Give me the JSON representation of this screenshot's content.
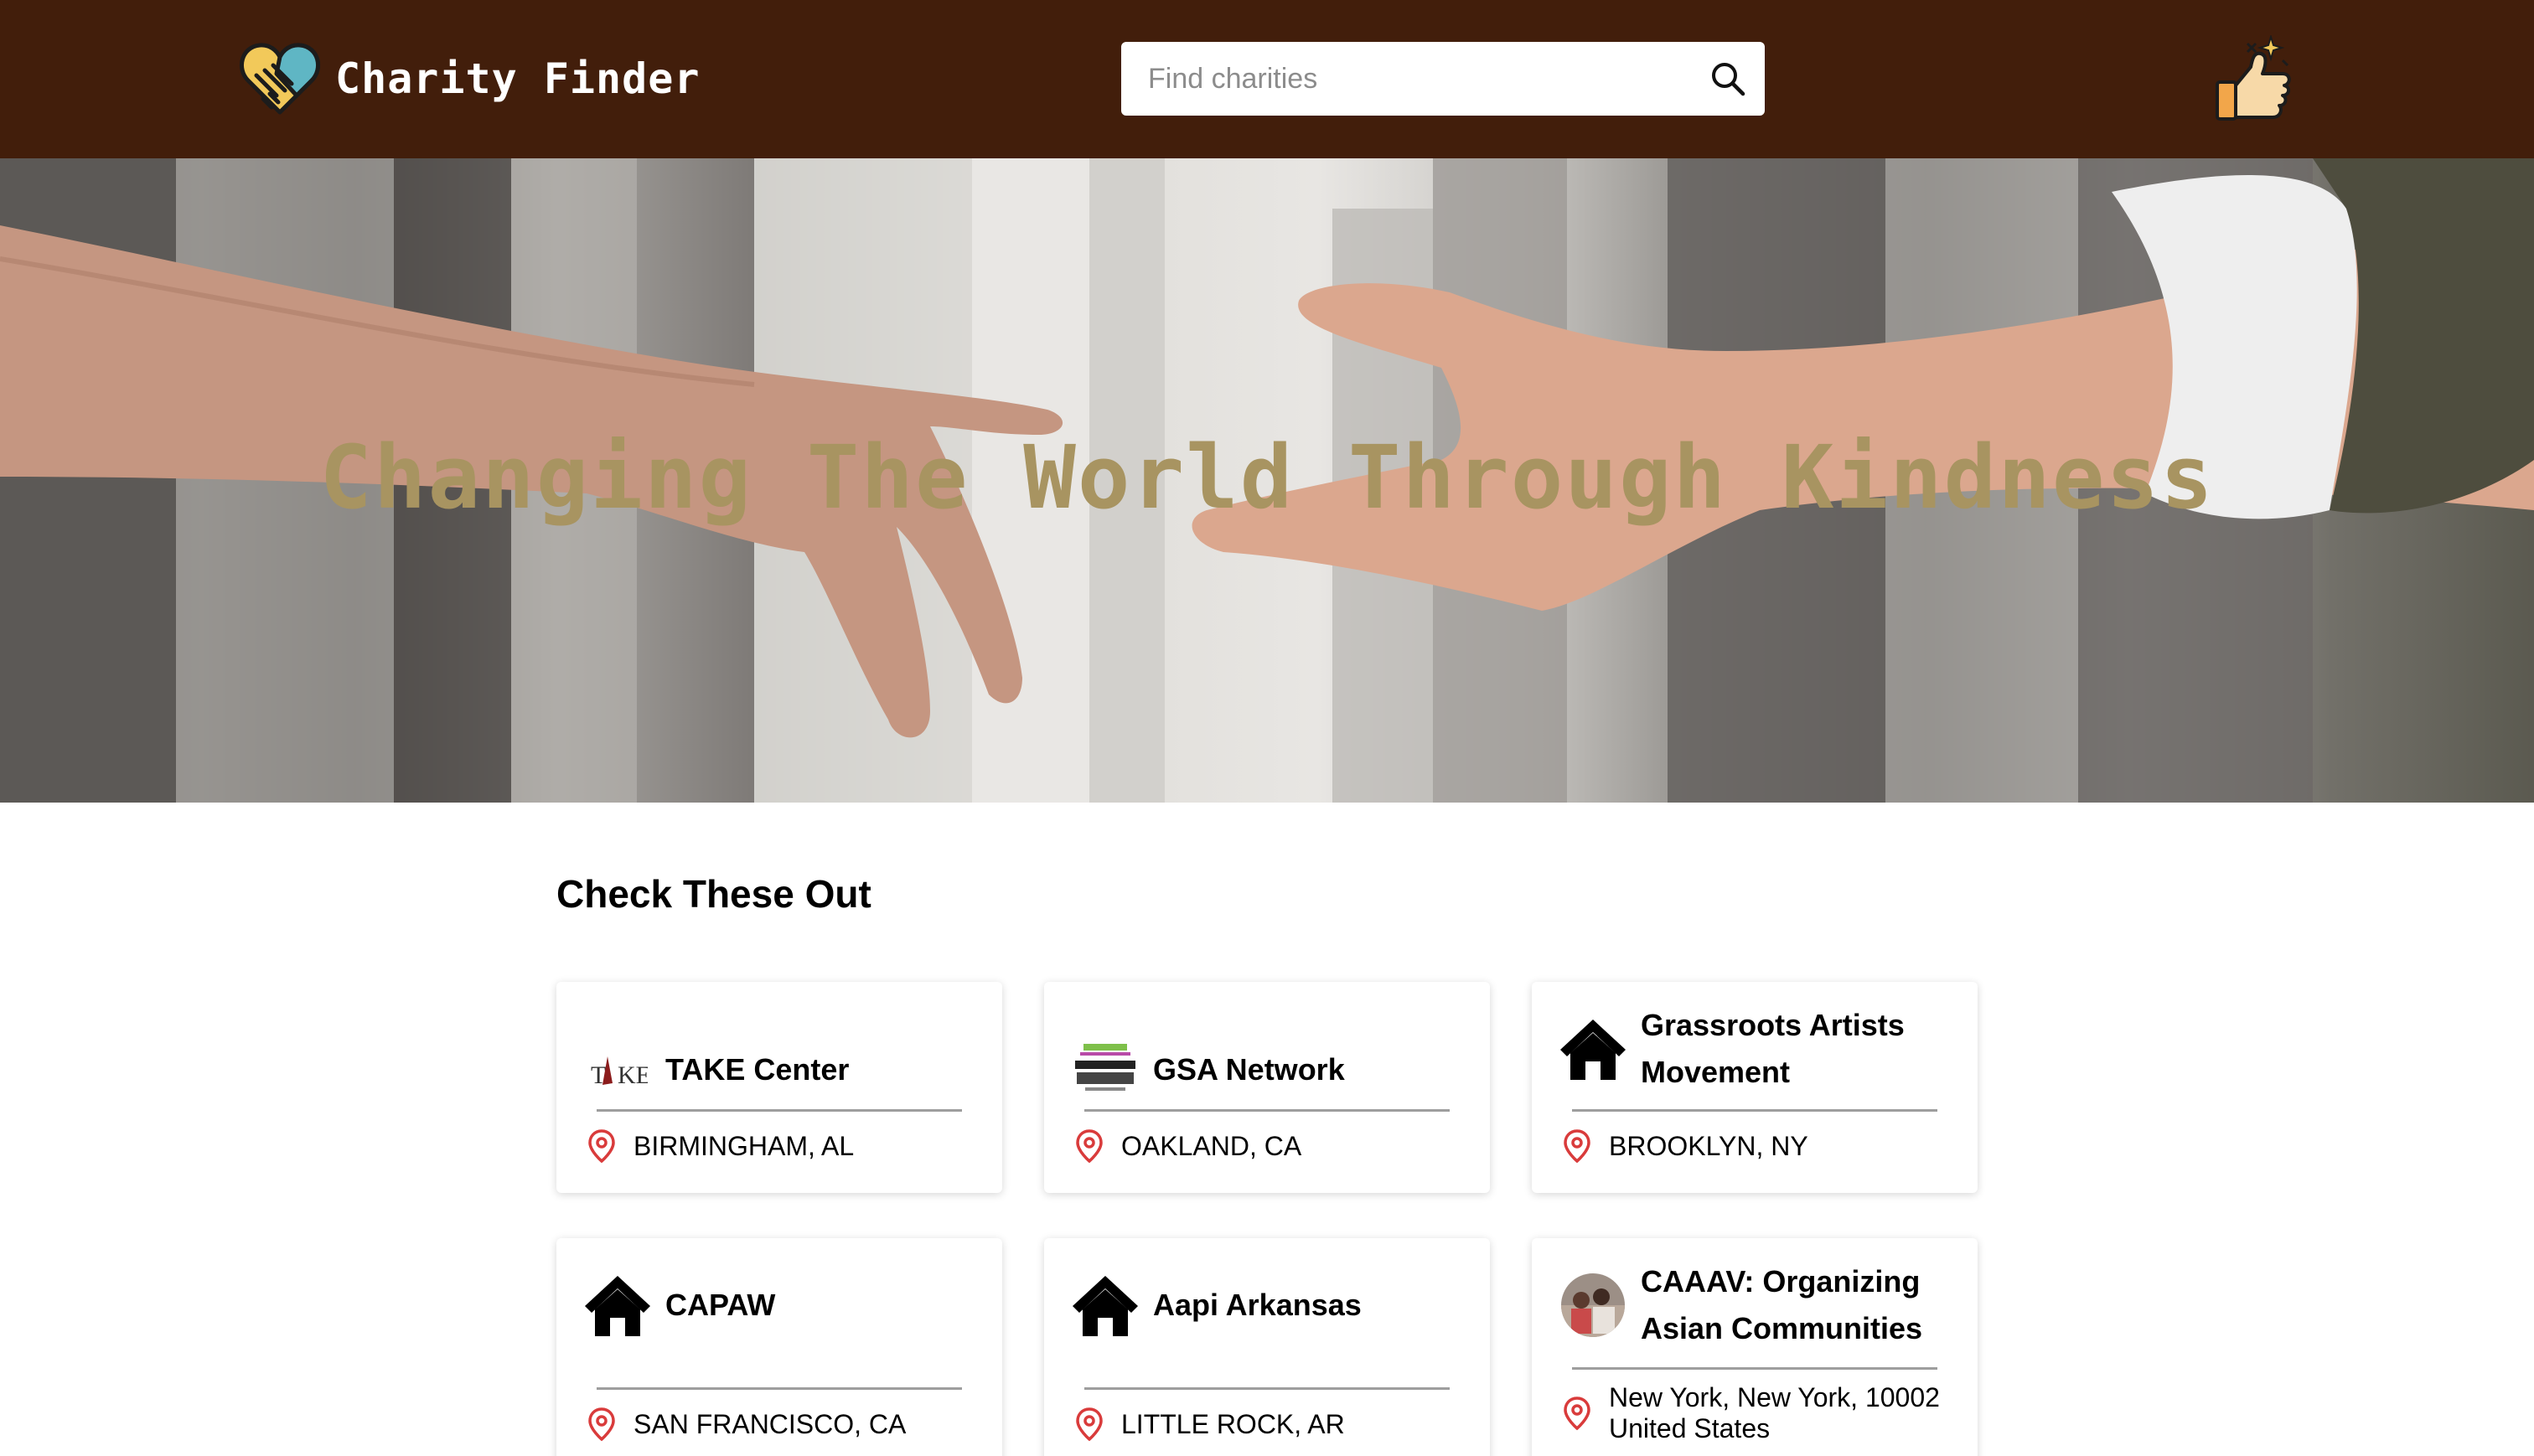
{
  "header": {
    "app_name": "Charity Finder",
    "logo_icon": "heart-handshake-icon",
    "search_placeholder": "Find charities",
    "search_icon": "search-icon",
    "favorites_icon": "thumbs-up-sparkle-icon"
  },
  "colors": {
    "header_bg": "#421e0b",
    "hero_title": "#a89461",
    "location_pin": "#d93b3b"
  },
  "hero": {
    "title": "Changing The World Through Kindness"
  },
  "main": {
    "section_title": "Check These Out",
    "cards": [
      {
        "name": "TAKE Center",
        "location": "BIRMINGHAM, AL",
        "logo_icon": "take-center-logo"
      },
      {
        "name": "GSA Network",
        "location": "OAKLAND, CA",
        "logo_icon": "gsa-network-logo"
      },
      {
        "name": "Grassroots Artists Movement",
        "location": "BROOKLYN, NY",
        "logo_icon": "house-icon"
      },
      {
        "name": "CAPAW",
        "location": "SAN FRANCISCO, CA",
        "logo_icon": "house-icon"
      },
      {
        "name": "Aapi Arkansas",
        "location": "LITTLE ROCK, AR",
        "logo_icon": "house-icon"
      },
      {
        "name": "CAAAV: Organizing Asian Communities",
        "location": "New York, New York, 10002\nUnited States",
        "logo_icon": "caaav-avatar"
      }
    ]
  }
}
